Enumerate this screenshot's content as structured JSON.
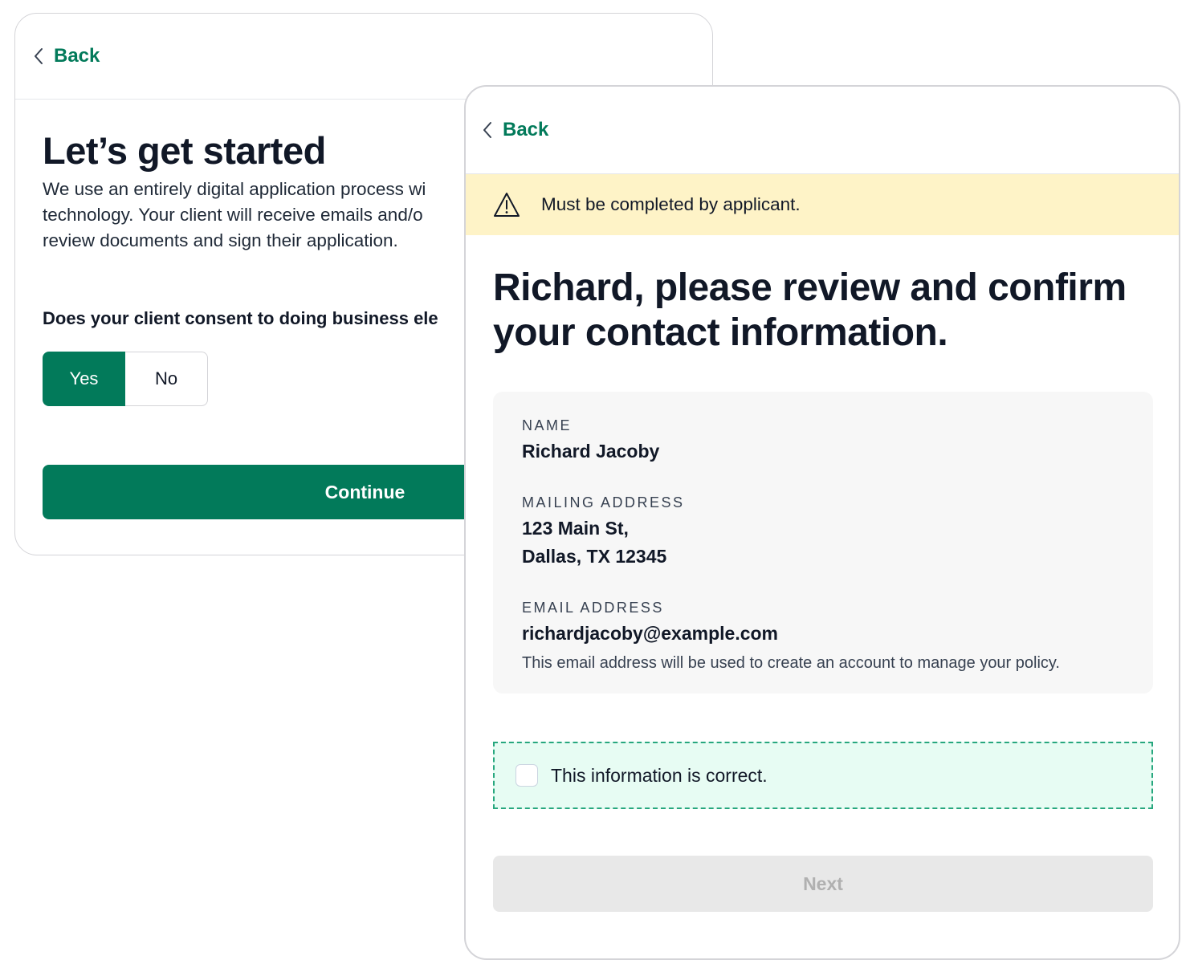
{
  "back_card": {
    "back_label": "Back",
    "title": "Let’s get started",
    "intro": "We use an entirely digital application process wi\ntechnology. Your client will receive emails and/o\nreview documents and sign their application.",
    "question": "Does your client consent to doing business ele",
    "yes_label": "Yes",
    "no_label": "No",
    "continue_label": "Continue"
  },
  "front_card": {
    "back_label": "Back",
    "warning": "Must be completed by applicant.",
    "title": "Richard, please review and confirm your contact information.",
    "name_label": "NAME",
    "name_value": "Richard Jacoby",
    "address_label": "MAILING ADDRESS",
    "address_line1": "123 Main St,",
    "address_line2": "Dallas, TX 12345",
    "email_label": "EMAIL ADDRESS",
    "email_value": "richardjacoby@example.com",
    "email_note": "This email address will be used to create an account to manage your policy.",
    "confirm_label": "This information is correct.",
    "next_label": "Next"
  }
}
